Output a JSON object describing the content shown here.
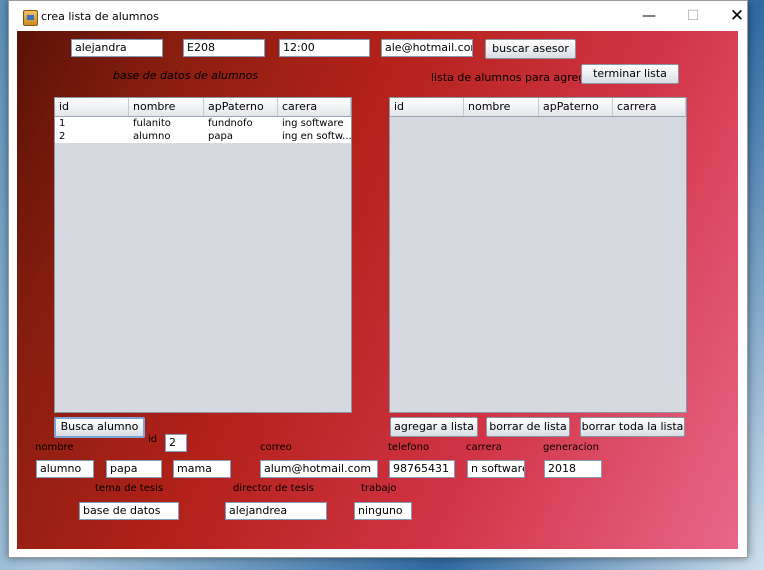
{
  "window": {
    "title": "crea lista de alumnos",
    "controls": {
      "minimize": "—",
      "maximize": "☐",
      "close": "✕"
    }
  },
  "top_bar": {
    "name_field": "alejandra",
    "room_field": "E208",
    "time_field": "12:00",
    "email_field": "ale@hotmail.com",
    "search_advisor_button": "buscar asesor"
  },
  "left_panel": {
    "title": "base de datos de alumnos",
    "columns": [
      "id",
      "nombre",
      "apPaterno",
      "carera"
    ],
    "rows": [
      [
        "1",
        "fulanito",
        "fundnofo",
        "ing software"
      ],
      [
        "2",
        "alumno",
        "papa",
        "ing en softw..."
      ]
    ]
  },
  "right_panel": {
    "title": "lista de alumnos para agregar",
    "finish_button": "terminar lista",
    "columns": [
      "id",
      "nombre",
      "apPaterno",
      "carrera"
    ],
    "rows": []
  },
  "actions": {
    "search_student": "Busca alumno",
    "add_to_list": "agregar a lista",
    "delete_from_list": "borrar de lista",
    "delete_all": "borrar toda la lista"
  },
  "form": {
    "id_label": "id",
    "id_value": "2",
    "nombre_label": "nombre",
    "nombre": "alumno",
    "ap_paterno": "papa",
    "ap_materno": "mama",
    "correo_label": "correo",
    "correo": "alum@hotmail.com",
    "telefono_label": "telefono",
    "telefono": "98765431",
    "carrera_label": "carrera",
    "carrera": "n software",
    "generacion_label": "generacion",
    "generacion": "2018",
    "tema_label": "tema de tesis",
    "tema": "base de datos",
    "director_label": "director de tesis",
    "director": "alejandrea",
    "trabajo_label": "trabajo",
    "trabajo": "ninguno"
  }
}
